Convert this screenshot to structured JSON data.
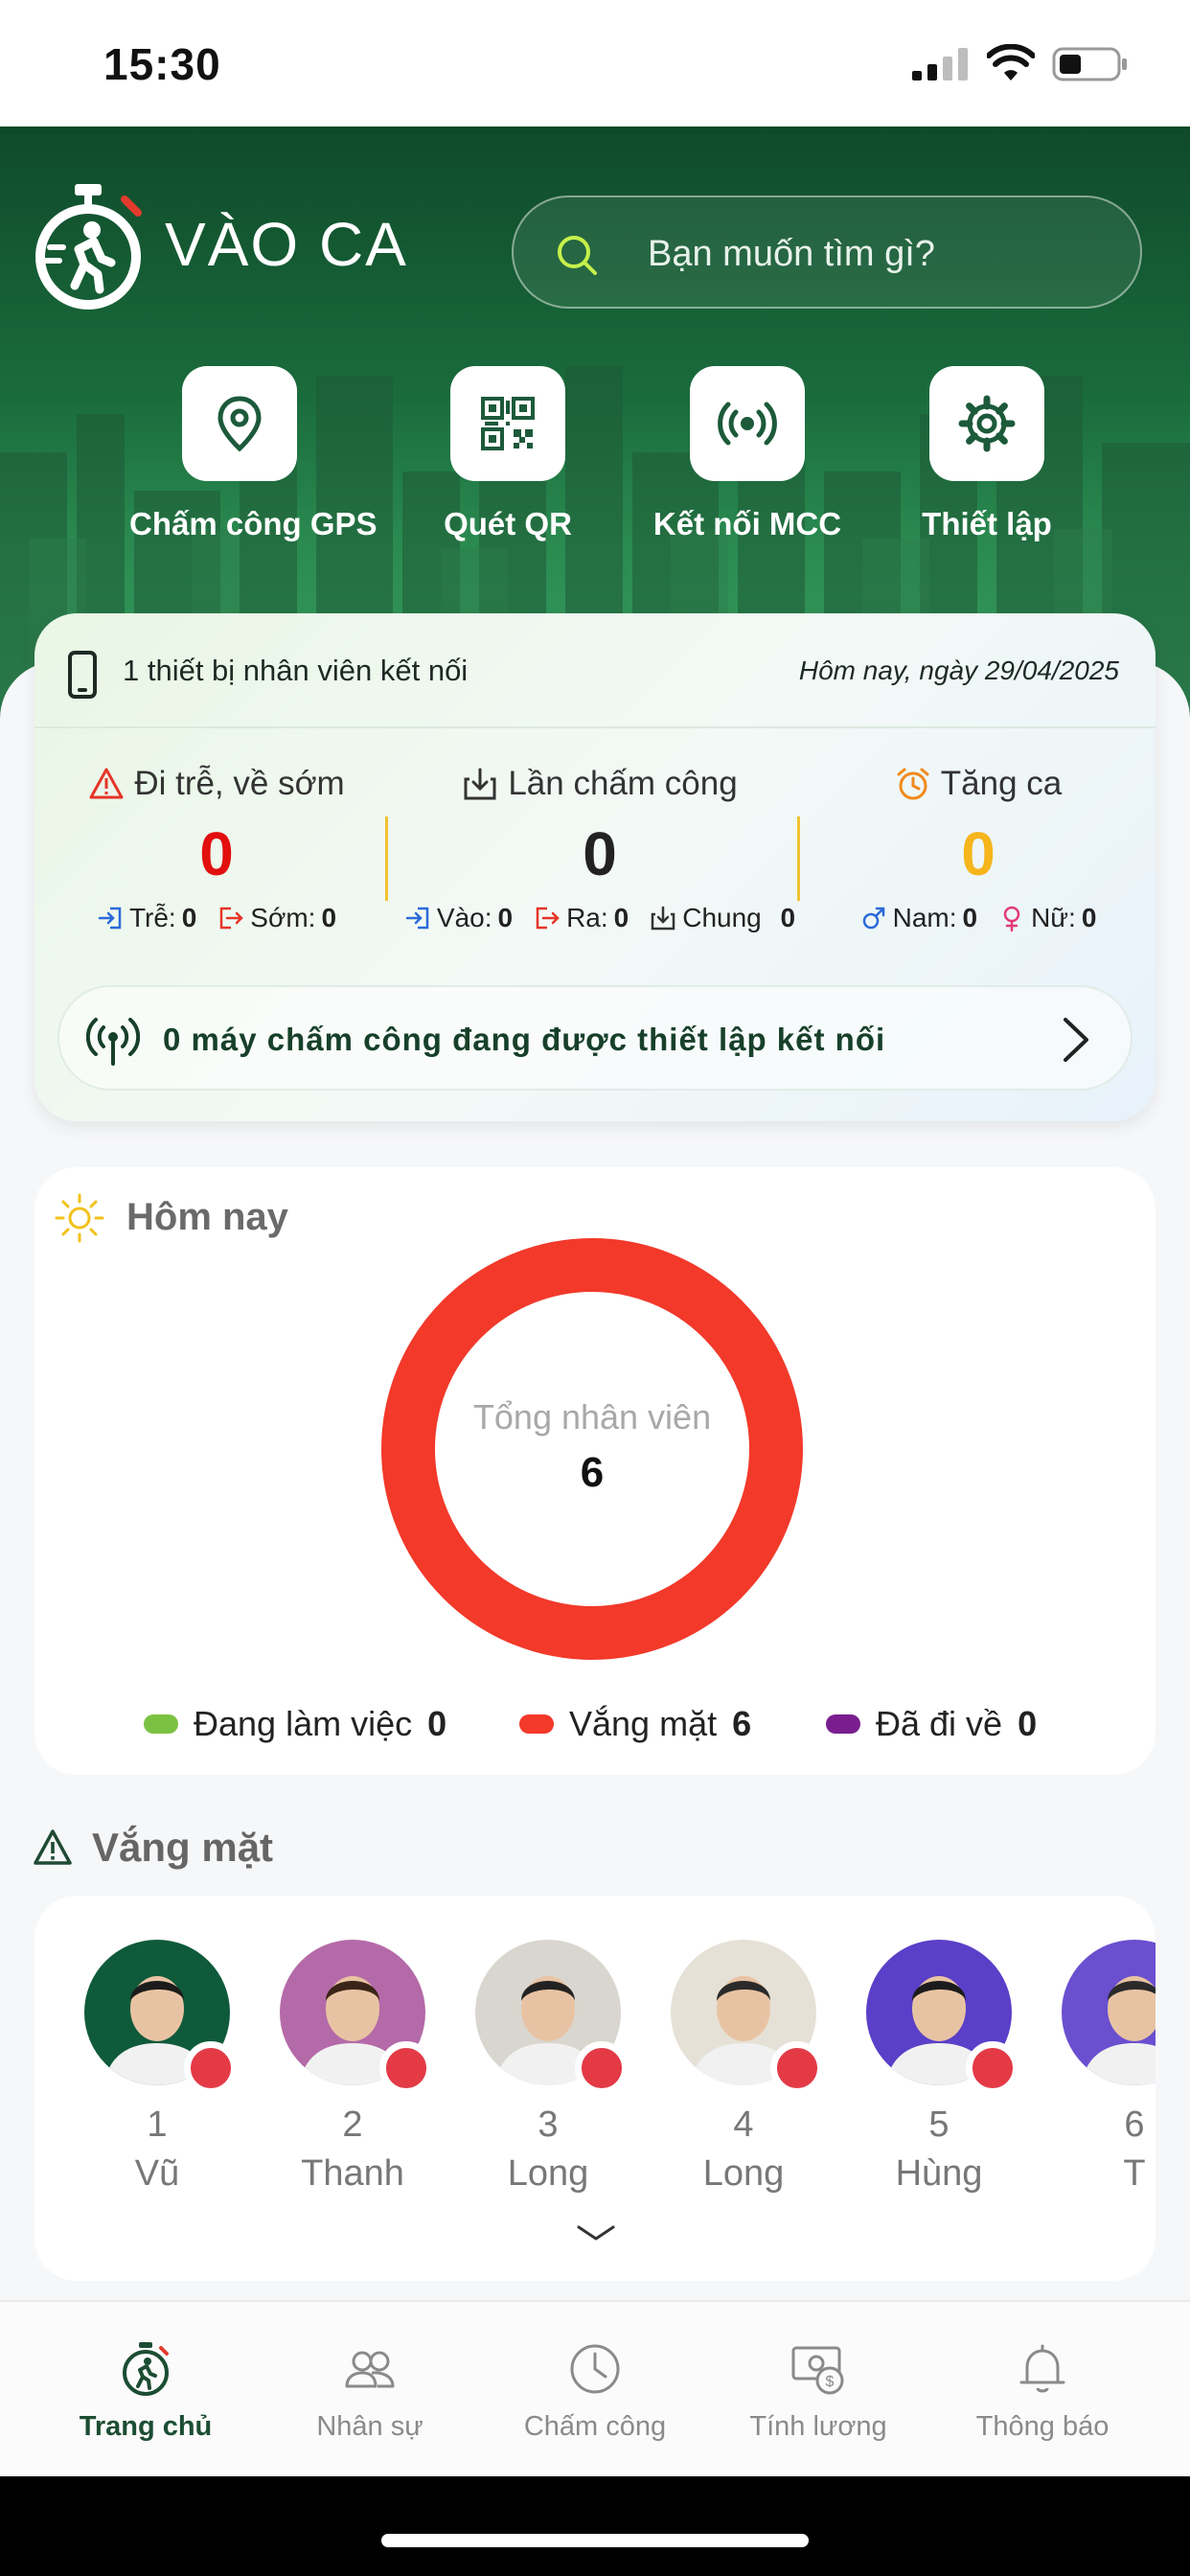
{
  "status_bar": {
    "time": "15:30"
  },
  "header": {
    "app_name": "VÀO CA",
    "search_placeholder": "Bạn muốn tìm gì?"
  },
  "quick_actions": [
    {
      "label": "Chấm công GPS",
      "icon": "location-pin-icon"
    },
    {
      "label": "Quét QR",
      "icon": "qr-code-icon"
    },
    {
      "label": "Kết nối MCC",
      "icon": "broadcast-icon"
    },
    {
      "label": "Thiết lập",
      "icon": "gear-icon"
    }
  ],
  "stats_card": {
    "device_text": "1 thiết bị nhân viên kết nối",
    "date_text": "Hôm nay, ngày 29/04/2025",
    "late_early": {
      "title": "Đi trễ, về sớm",
      "value": "0",
      "late_label": "Trễ:",
      "late_value": "0",
      "early_label": "Sớm:",
      "early_value": "0"
    },
    "checkins": {
      "title": "Lần chấm công",
      "value": "0",
      "in_label": "Vào:",
      "in_value": "0",
      "out_label": "Ra:",
      "out_value": "0",
      "common_label": "Chung",
      "common_value": "0"
    },
    "overtime": {
      "title": "Tăng ca",
      "value": "0",
      "male_label": "Nam:",
      "male_value": "0",
      "female_label": "Nữ:",
      "female_value": "0"
    },
    "machines_text": "0 máy chấm công đang được thiết lập kết nối"
  },
  "today": {
    "title": "Hôm nay",
    "total_label": "Tổng nhân viên",
    "total_value": "6",
    "legend": [
      {
        "label": "Đang làm việc",
        "value": "0",
        "color": "#7cc242"
      },
      {
        "label": "Vắng mặt",
        "value": "6",
        "color": "#f2392a"
      },
      {
        "label": "Đã đi về",
        "value": "0",
        "color": "#7a1e8f"
      }
    ]
  },
  "absent": {
    "title": "Vắng mặt",
    "people": [
      {
        "num": "1",
        "name": "Vũ",
        "bg": "#0f5a3a"
      },
      {
        "num": "2",
        "name": "Thanh",
        "bg": "#b46aa8"
      },
      {
        "num": "3",
        "name": "Long",
        "bg": "#d9d6cf"
      },
      {
        "num": "4",
        "name": "Long",
        "bg": "#e6e1d6"
      },
      {
        "num": "5",
        "name": "Hùng",
        "bg": "#5a3fc8"
      },
      {
        "num": "6",
        "name": "T",
        "bg": "#6a4fcf"
      }
    ]
  },
  "tabs": [
    {
      "label": "Trang chủ",
      "icon": "home-stopwatch-icon",
      "active": true
    },
    {
      "label": "Nhân sự",
      "icon": "people-icon",
      "active": false
    },
    {
      "label": "Chấm công",
      "icon": "clock-icon",
      "active": false
    },
    {
      "label": "Tính lương",
      "icon": "payroll-icon",
      "active": false
    },
    {
      "label": "Thông báo",
      "icon": "bell-icon",
      "active": false
    }
  ]
}
